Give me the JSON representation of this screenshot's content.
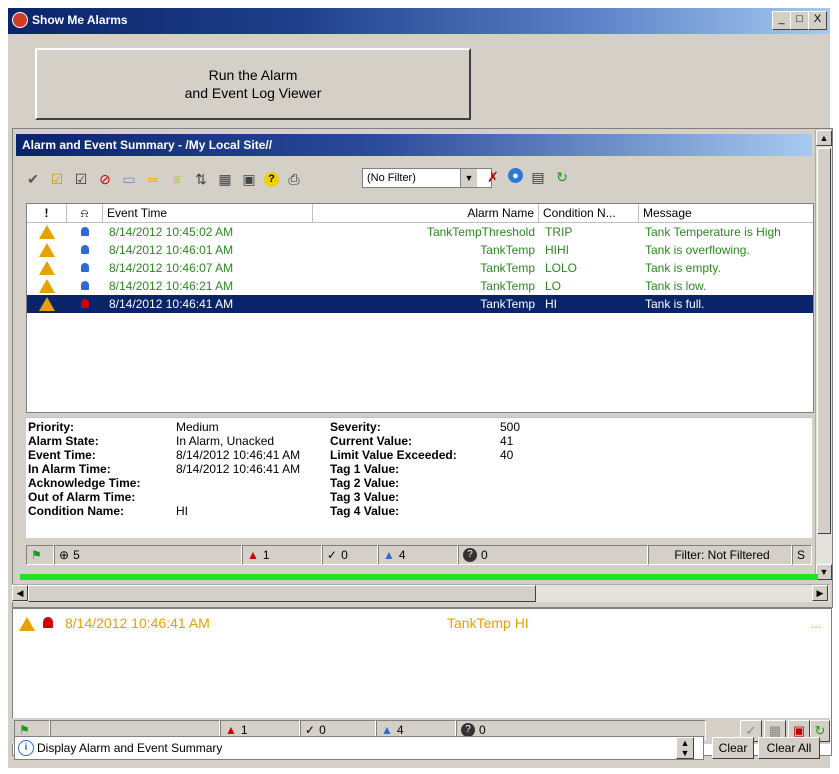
{
  "window": {
    "title": "Show Me Alarms",
    "minimize": "_",
    "maximize": "□",
    "close": "X"
  },
  "run_button": {
    "line1": "Run the Alarm",
    "line2": "and Event Log Viewer"
  },
  "summary": {
    "title": "Alarm and Event Summary - /My Local Site//",
    "filter_value": "(No Filter)",
    "columns": [
      "!",
      "⍾",
      "Event Time",
      "Alarm Name",
      "Condition N...",
      "Message"
    ],
    "rows": [
      {
        "event_time": "8/14/2012 10:45:02 AM",
        "alarm_name": "TankTempThreshold",
        "condition": "TRIP",
        "message": "Tank Temperature is High"
      },
      {
        "event_time": "8/14/2012 10:46:01 AM",
        "alarm_name": "TankTemp",
        "condition": "HIHI",
        "message": "Tank is overflowing."
      },
      {
        "event_time": "8/14/2012 10:46:07 AM",
        "alarm_name": "TankTemp",
        "condition": "LOLO",
        "message": "Tank is empty."
      },
      {
        "event_time": "8/14/2012 10:46:21 AM",
        "alarm_name": "TankTemp",
        "condition": "LO",
        "message": "Tank is low."
      },
      {
        "event_time": "8/14/2012 10:46:41 AM",
        "alarm_name": "TankTemp",
        "condition": "HI",
        "message": "Tank is full."
      }
    ],
    "selected_row_index": 4,
    "details": {
      "priority_label": "Priority:",
      "priority": "Medium",
      "alarm_state_label": "Alarm State:",
      "alarm_state": "In Alarm, Unacked",
      "event_time_label": "Event Time:",
      "event_time": "8/14/2012 10:46:41 AM",
      "in_alarm_time_label": "In Alarm Time:",
      "in_alarm_time": "8/14/2012 10:46:41 AM",
      "ack_time_label": "Acknowledge Time:",
      "out_alarm_label": "Out of Alarm Time:",
      "condition_label": "Condition Name:",
      "condition": "HI",
      "severity_label": "Severity:",
      "severity": "500",
      "current_value_label": "Current Value:",
      "current_value": "41",
      "limit_label": "Limit Value Exceeded:",
      "limit": "40",
      "tag1_label": "Tag 1 Value:",
      "tag2_label": "Tag 2 Value:",
      "tag3_label": "Tag 3 Value:",
      "tag4_label": "Tag 4 Value:"
    },
    "status": {
      "total": "5",
      "in_alarm": "1",
      "normal_unacked": "0",
      "unacked": "4",
      "faulted": "0",
      "filter": "Filter: Not Filtered",
      "cut": "S"
    }
  },
  "banner": {
    "time": "8/14/2012 10:46:41 AM",
    "name": "TankTemp HI",
    "more": "...",
    "status": {
      "in_alarm": "1",
      "normal_unacked": "0",
      "unacked": "4",
      "faulted": "0"
    }
  },
  "diagnostics": {
    "message": "Display Alarm and Event Summary",
    "clear": "Clear",
    "clear_all": "Clear All"
  },
  "colors": {
    "event_green": "#2b8a1e",
    "banner_orange": "#e8a000",
    "selection": "#0a246a",
    "progress_green": "#22e022"
  }
}
